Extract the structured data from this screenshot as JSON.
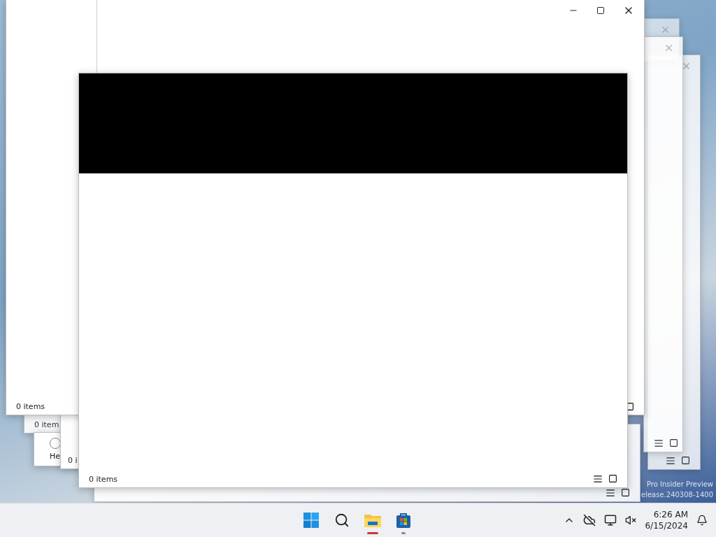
{
  "desktop": {
    "watermark": [
      "Pro Insider Preview",
      "elease.240308-1400"
    ]
  },
  "windows": [
    {
      "kind": "stub",
      "footer_icons": true
    },
    {
      "kind": "stub",
      "footer_icons": false
    },
    {
      "kind": "stub",
      "footer_icons": true
    },
    {
      "kind": "blank",
      "footer_icons": true
    },
    {
      "kind": "blank",
      "status": "0 item"
    },
    {
      "kind": "partial",
      "text": "He"
    },
    {
      "kind": "blank",
      "status": "0 i"
    },
    {
      "kind": "main",
      "status": "0 items",
      "footer_icons": true
    },
    {
      "kind": "front",
      "status": "0 items",
      "footer_icons": true
    }
  ],
  "taskbar": {
    "apps": [
      {
        "kind": "start"
      },
      {
        "kind": "search"
      },
      {
        "kind": "explorer",
        "running": true,
        "color": "#d13438"
      },
      {
        "kind": "store",
        "running": true,
        "color": "#8a8a8a"
      }
    ],
    "clock": {
      "time": "6:26 AM",
      "date": "6/15/2024"
    }
  }
}
